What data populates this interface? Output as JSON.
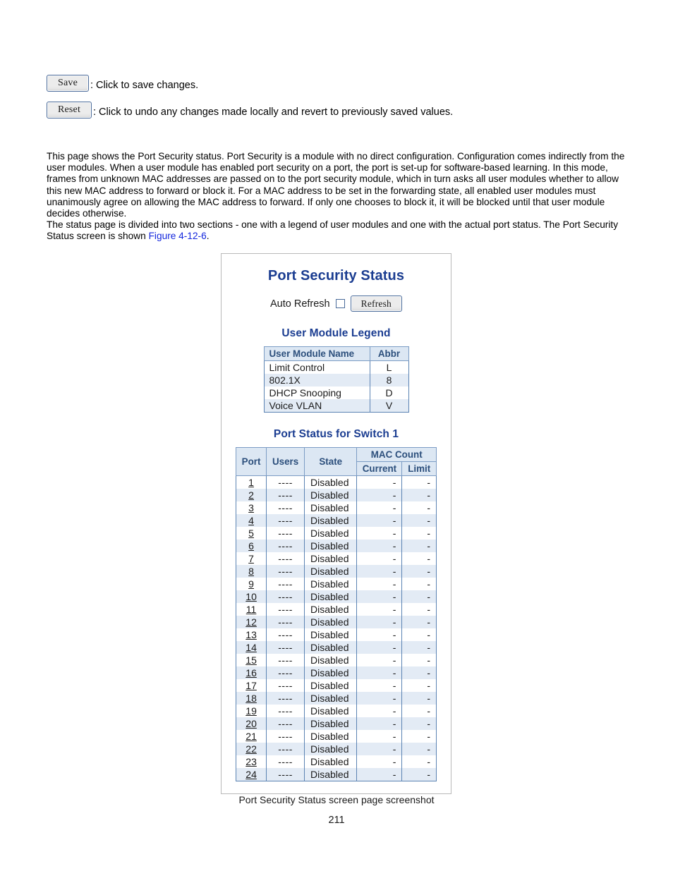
{
  "buttons": [
    {
      "label": "Save",
      "description": ": Click to save changes."
    },
    {
      "label": "Reset",
      "description": ": Click to undo any changes made locally and revert to previously saved values."
    }
  ],
  "paragraphs": {
    "p1": "This page shows the Port Security status. Port Security is a module with no direct configuration. Configuration comes indirectly from the user modules. When a user module has enabled port security on a port, the port is set-up for software-based learning. In this mode, frames from unknown MAC addresses are passed on to the port security module, which in turn asks all user modules whether to allow this new MAC address to forward or block it. For a MAC address to be set in the forwarding state, all enabled user modules must unanimously agree on allowing the MAC address to forward. If only one chooses to block it, it will be blocked until that user module decides otherwise.",
    "p2_before_link": "The status page is divided into two sections - one with a legend of user modules and one with the actual port status. The Port Security Status screen is shown ",
    "p2_link": "Figure 4-12-6",
    "p2_after_link": "."
  },
  "screenshot": {
    "title": "Port Security Status",
    "auto_refresh_label": "Auto Refresh",
    "refresh_button": "Refresh",
    "legend_heading": "User Module Legend",
    "legend_table": {
      "headers": [
        "User Module Name",
        "Abbr"
      ],
      "rows": [
        {
          "name": "Limit Control",
          "abbr": "L"
        },
        {
          "name": "802.1X",
          "abbr": "8"
        },
        {
          "name": "DHCP Snooping",
          "abbr": "D"
        },
        {
          "name": "Voice VLAN",
          "abbr": "V"
        }
      ]
    },
    "port_status_heading": "Port Status for Switch 1",
    "port_table": {
      "headers": {
        "port": "Port",
        "users": "Users",
        "state": "State",
        "mac_count": "MAC Count",
        "current": "Current",
        "limit": "Limit"
      },
      "rows": [
        {
          "port": "1",
          "users": "----",
          "state": "Disabled",
          "current": "-",
          "limit": "-"
        },
        {
          "port": "2",
          "users": "----",
          "state": "Disabled",
          "current": "-",
          "limit": "-"
        },
        {
          "port": "3",
          "users": "----",
          "state": "Disabled",
          "current": "-",
          "limit": "-"
        },
        {
          "port": "4",
          "users": "----",
          "state": "Disabled",
          "current": "-",
          "limit": "-"
        },
        {
          "port": "5",
          "users": "----",
          "state": "Disabled",
          "current": "-",
          "limit": "-"
        },
        {
          "port": "6",
          "users": "----",
          "state": "Disabled",
          "current": "-",
          "limit": "-"
        },
        {
          "port": "7",
          "users": "----",
          "state": "Disabled",
          "current": "-",
          "limit": "-"
        },
        {
          "port": "8",
          "users": "----",
          "state": "Disabled",
          "current": "-",
          "limit": "-"
        },
        {
          "port": "9",
          "users": "----",
          "state": "Disabled",
          "current": "-",
          "limit": "-"
        },
        {
          "port": "10",
          "users": "----",
          "state": "Disabled",
          "current": "-",
          "limit": "-"
        },
        {
          "port": "11",
          "users": "----",
          "state": "Disabled",
          "current": "-",
          "limit": "-"
        },
        {
          "port": "12",
          "users": "----",
          "state": "Disabled",
          "current": "-",
          "limit": "-"
        },
        {
          "port": "13",
          "users": "----",
          "state": "Disabled",
          "current": "-",
          "limit": "-"
        },
        {
          "port": "14",
          "users": "----",
          "state": "Disabled",
          "current": "-",
          "limit": "-"
        },
        {
          "port": "15",
          "users": "----",
          "state": "Disabled",
          "current": "-",
          "limit": "-"
        },
        {
          "port": "16",
          "users": "----",
          "state": "Disabled",
          "current": "-",
          "limit": "-"
        },
        {
          "port": "17",
          "users": "----",
          "state": "Disabled",
          "current": "-",
          "limit": "-"
        },
        {
          "port": "18",
          "users": "----",
          "state": "Disabled",
          "current": "-",
          "limit": "-"
        },
        {
          "port": "19",
          "users": "----",
          "state": "Disabled",
          "current": "-",
          "limit": "-"
        },
        {
          "port": "20",
          "users": "----",
          "state": "Disabled",
          "current": "-",
          "limit": "-"
        },
        {
          "port": "21",
          "users": "----",
          "state": "Disabled",
          "current": "-",
          "limit": "-"
        },
        {
          "port": "22",
          "users": "----",
          "state": "Disabled",
          "current": "-",
          "limit": "-"
        },
        {
          "port": "23",
          "users": "----",
          "state": "Disabled",
          "current": "-",
          "limit": "-"
        },
        {
          "port": "24",
          "users": "----",
          "state": "Disabled",
          "current": "-",
          "limit": "-"
        }
      ]
    }
  },
  "figure_caption": "Port Security Status screen page screenshot",
  "page_number": "211",
  "colors": {
    "heading_blue": "#1b3d91",
    "link_blue": "#1427dd",
    "table_header_bg": "#dce7f3",
    "table_alt_row_bg": "#e3ebf5",
    "table_border": "#5b83b3",
    "panel_border": "#b9b9b9"
  }
}
